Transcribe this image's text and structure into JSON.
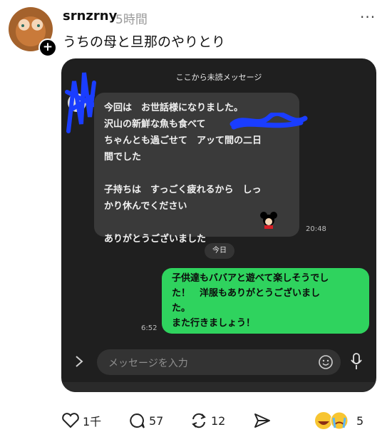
{
  "post": {
    "username": "srnzrny",
    "time_ago": "5時間",
    "text": "うちの母と旦那のやりとり",
    "more_icon": "more-dots-icon"
  },
  "chat": {
    "unread_divider": "ここから未読メッセージ",
    "received_message": "今回は　お世話様になりました。\n沢山の新鮮な魚も食べて\nちゃんとも過ごせて　アッて間の二日\n間でした\n\n子持ちは　すっごく疲れるから　しっ\nかり休んでください\n\nありがとうございました",
    "received_time": "20:48",
    "date_divider": "今日",
    "sent_message": "子供達もババアと遊べて楽しそうでし\nた！　洋服もありがとうございまし\nた。\nまた行きましょう！",
    "sent_time": "6:52",
    "input_placeholder": "メッセージを入力",
    "colors": {
      "background": "#1f1f1f",
      "received_bubble": "#3a3a3a",
      "sent_bubble": "#2fd35e"
    }
  },
  "actions": {
    "likes": "1千",
    "replies": "57",
    "reposts": "12",
    "reactions": "5"
  }
}
